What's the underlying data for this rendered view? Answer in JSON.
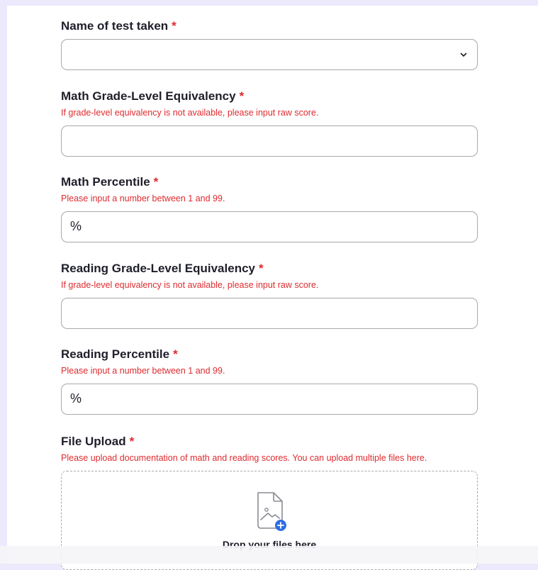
{
  "form": {
    "required_marker": "*",
    "test_name": {
      "label": "Name of test taken",
      "value": ""
    },
    "math_grade": {
      "label": "Math Grade-Level Equivalency",
      "help": "If grade-level equivalency is not available, please input raw score.",
      "value": ""
    },
    "math_percentile": {
      "label": "Math Percentile",
      "help": "Please input a number between 1 and 99.",
      "suffix": "%"
    },
    "reading_grade": {
      "label": "Reading Grade-Level Equivalency",
      "help": "If grade-level equivalency is not available, please input raw score.",
      "value": ""
    },
    "reading_percentile": {
      "label": "Reading Percentile",
      "help": "Please input a number between 1 and 99.",
      "suffix": "%"
    },
    "file_upload": {
      "label": "File Upload",
      "help": "Please upload documentation of math and reading scores. You can upload multiple files here.",
      "drop_text": "Drop your files here",
      "icon": "image-file-add-icon"
    }
  },
  "colors": {
    "page_background": "#ebe9fb",
    "required": "#e0282e",
    "help_text": "#de2b2f",
    "border": "#a8a8b0",
    "upload_accent": "#2f6fe0"
  }
}
